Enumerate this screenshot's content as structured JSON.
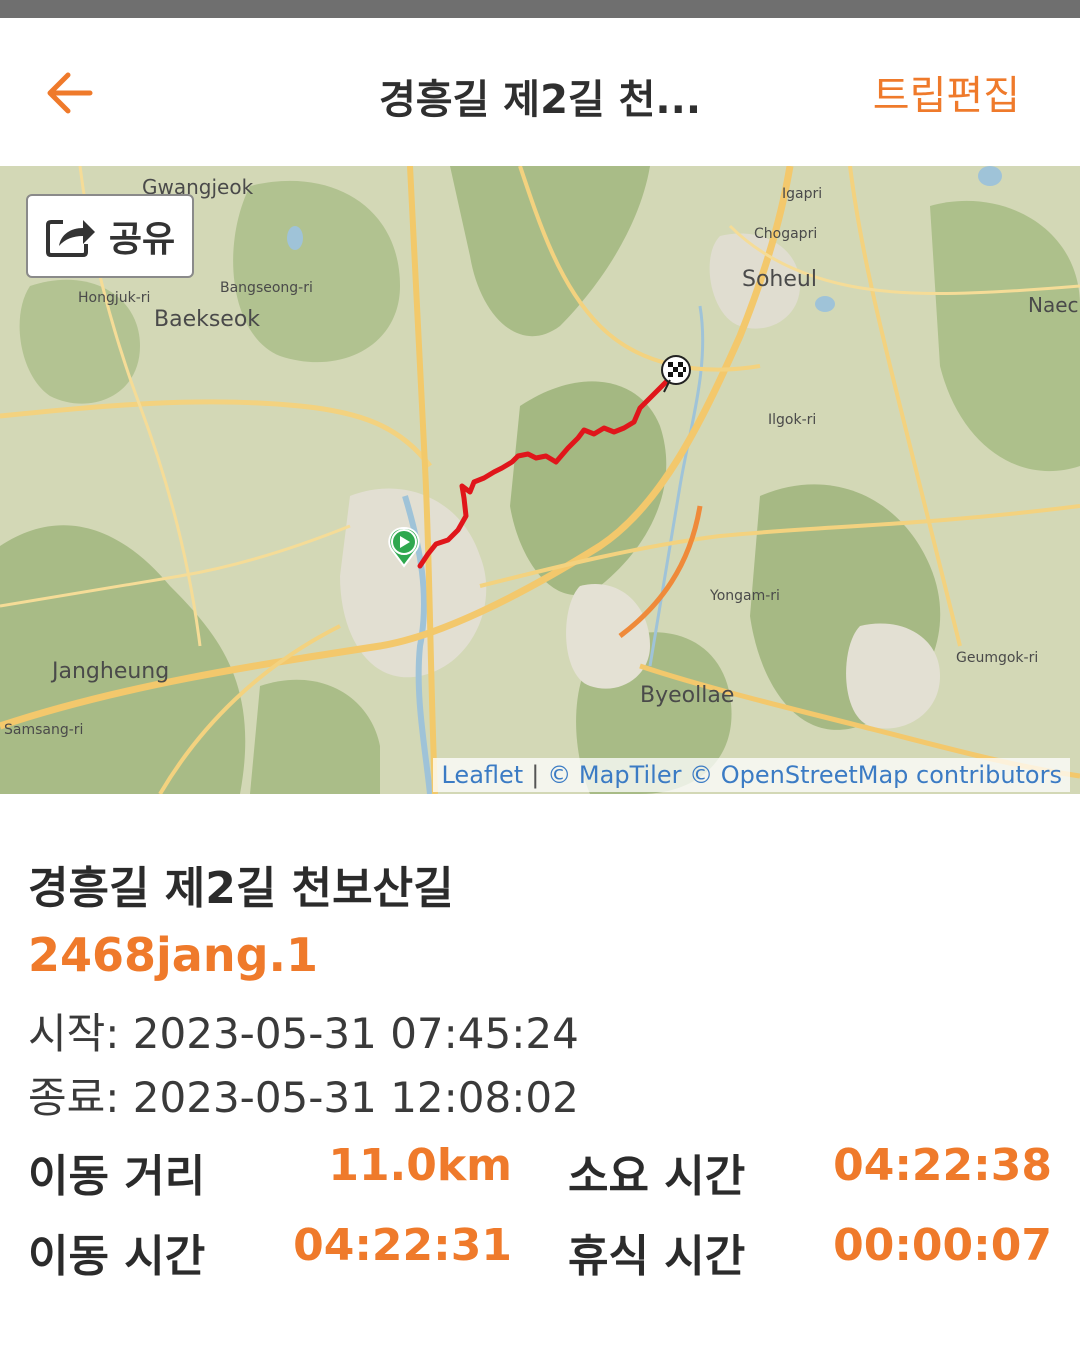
{
  "header": {
    "title": "경흥길 제2길 천...",
    "edit_label": "트립편집"
  },
  "map": {
    "share_label": "공유",
    "attribution": {
      "leaflet": "Leaflet",
      "separator": "|",
      "maptiler": "© MapTiler",
      "osm": "© OpenStreetMap contributors"
    },
    "place_labels": {
      "gwangjeok": "Gwangjeok",
      "baekseok": "Baekseok",
      "soheul": "Soheul",
      "jangheung": "Jangheung",
      "byeollae": "Byeollae",
      "naec": "Naec",
      "igapri": "Igapri",
      "chogapri": "Chogapri",
      "hongjukri": "Hongjuk-ri",
      "bangseongri": "Bangseong-ri",
      "ilgokri": "Ilgok-ri",
      "yongamri": "Yongam-ri",
      "geumgokri": "Geumgok-ri",
      "samsangri": "Samsang-ri"
    }
  },
  "trip": {
    "name": "경흥길 제2길 천보산길",
    "user": "2468jang.1",
    "start": "시작: 2023-05-31 07:45:24",
    "end": "종료: 2023-05-31 12:08:02"
  },
  "stats": {
    "distance_label": "이동 거리",
    "distance_value": "11.0km",
    "elapsed_label": "소요 시간",
    "elapsed_value": "04:22:38",
    "moving_label": "이동 시간",
    "moving_value": "04:22:31",
    "rest_label": "휴식 시간",
    "rest_value": "00:00:07"
  },
  "colors": {
    "accent": "#ef7a2b",
    "route": "#e0161b",
    "start_marker": "#2fa84f"
  }
}
